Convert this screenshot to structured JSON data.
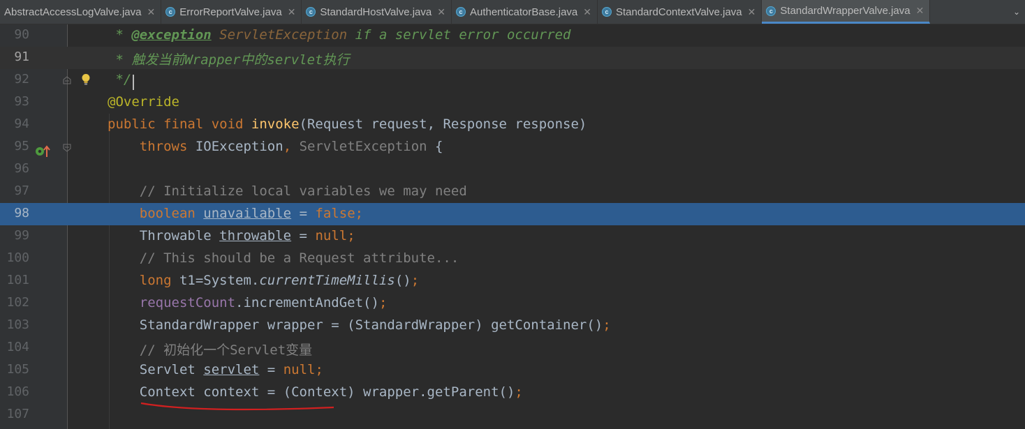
{
  "tabs": [
    {
      "label": "AbstractAccessLogValve.java",
      "active": false,
      "icon": "none"
    },
    {
      "label": "ErrorReportValve.java",
      "active": false,
      "icon": "class-icon"
    },
    {
      "label": "StandardHostValve.java",
      "active": false,
      "icon": "class-icon"
    },
    {
      "label": "AuthenticatorBase.java",
      "active": false,
      "icon": "class-icon"
    },
    {
      "label": "StandardContextValve.java",
      "active": false,
      "icon": "class-icon"
    },
    {
      "label": "StandardWrapperValve.java",
      "active": true,
      "icon": "class-icon"
    }
  ],
  "tab_close_glyph": "✕",
  "tab_more_glyph": "⌄",
  "class_icon_letter": "c",
  "lines": [
    {
      "num": "90"
    },
    {
      "num": "91"
    },
    {
      "num": "92"
    },
    {
      "num": "93"
    },
    {
      "num": "94"
    },
    {
      "num": "95"
    },
    {
      "num": "96"
    },
    {
      "num": "97"
    },
    {
      "num": "98"
    },
    {
      "num": "99"
    },
    {
      "num": "100"
    },
    {
      "num": "101"
    },
    {
      "num": "102"
    },
    {
      "num": "103"
    },
    {
      "num": "104"
    },
    {
      "num": "105"
    },
    {
      "num": "106"
    },
    {
      "num": "107"
    }
  ],
  "code": {
    "l90": {
      "star": " * ",
      "tag": "@exception",
      "ref": " ServletException",
      "text": " if a servlet error occurred"
    },
    "l91": {
      "star": " * ",
      "text": "触发当前Wrapper中的servlet执行"
    },
    "l92": {
      "text": " */"
    },
    "l93": {
      "text": "@Override"
    },
    "l94": {
      "kw": "public final void ",
      "fn": "invoke",
      "text": "(Request request, Response response)"
    },
    "l95": {
      "kw": "    throws ",
      "text": "IOException",
      "comma": ", ",
      "gray": "ServletException",
      "tail": " {"
    },
    "l97": {
      "text": "    // Initialize local variables we may need"
    },
    "l98": {
      "kw": "    boolean ",
      "var": "unavailable",
      "eq": " = ",
      "kw2": "false;"
    },
    "l99": {
      "pre": "    Throwable ",
      "var": "throwable",
      "eq": " = ",
      "kw2": "null;"
    },
    "l100": {
      "text": "    // This should be a Request attribute..."
    },
    "l101": {
      "kw": "    long ",
      "pre": "t1=System.",
      "stat": "currentTimeMillis",
      "tail": "()",
      "semi": ";"
    },
    "l102": {
      "field": "    requestCount",
      "tail": ".incrementAndGet()",
      "semi": ";"
    },
    "l103": {
      "pre": "    StandardWrapper wrapper = (StandardWrapper) getContainer()",
      "semi": ";"
    },
    "l104": {
      "text": "    // 初始化一个Servlet变量"
    },
    "l105": {
      "pre": "    Servlet ",
      "var": "servlet",
      "eq": " = ",
      "kw2": "null;"
    },
    "l106": {
      "pre": "    Context context = (Context) wrapper.getParent()",
      "semi": ";"
    }
  }
}
